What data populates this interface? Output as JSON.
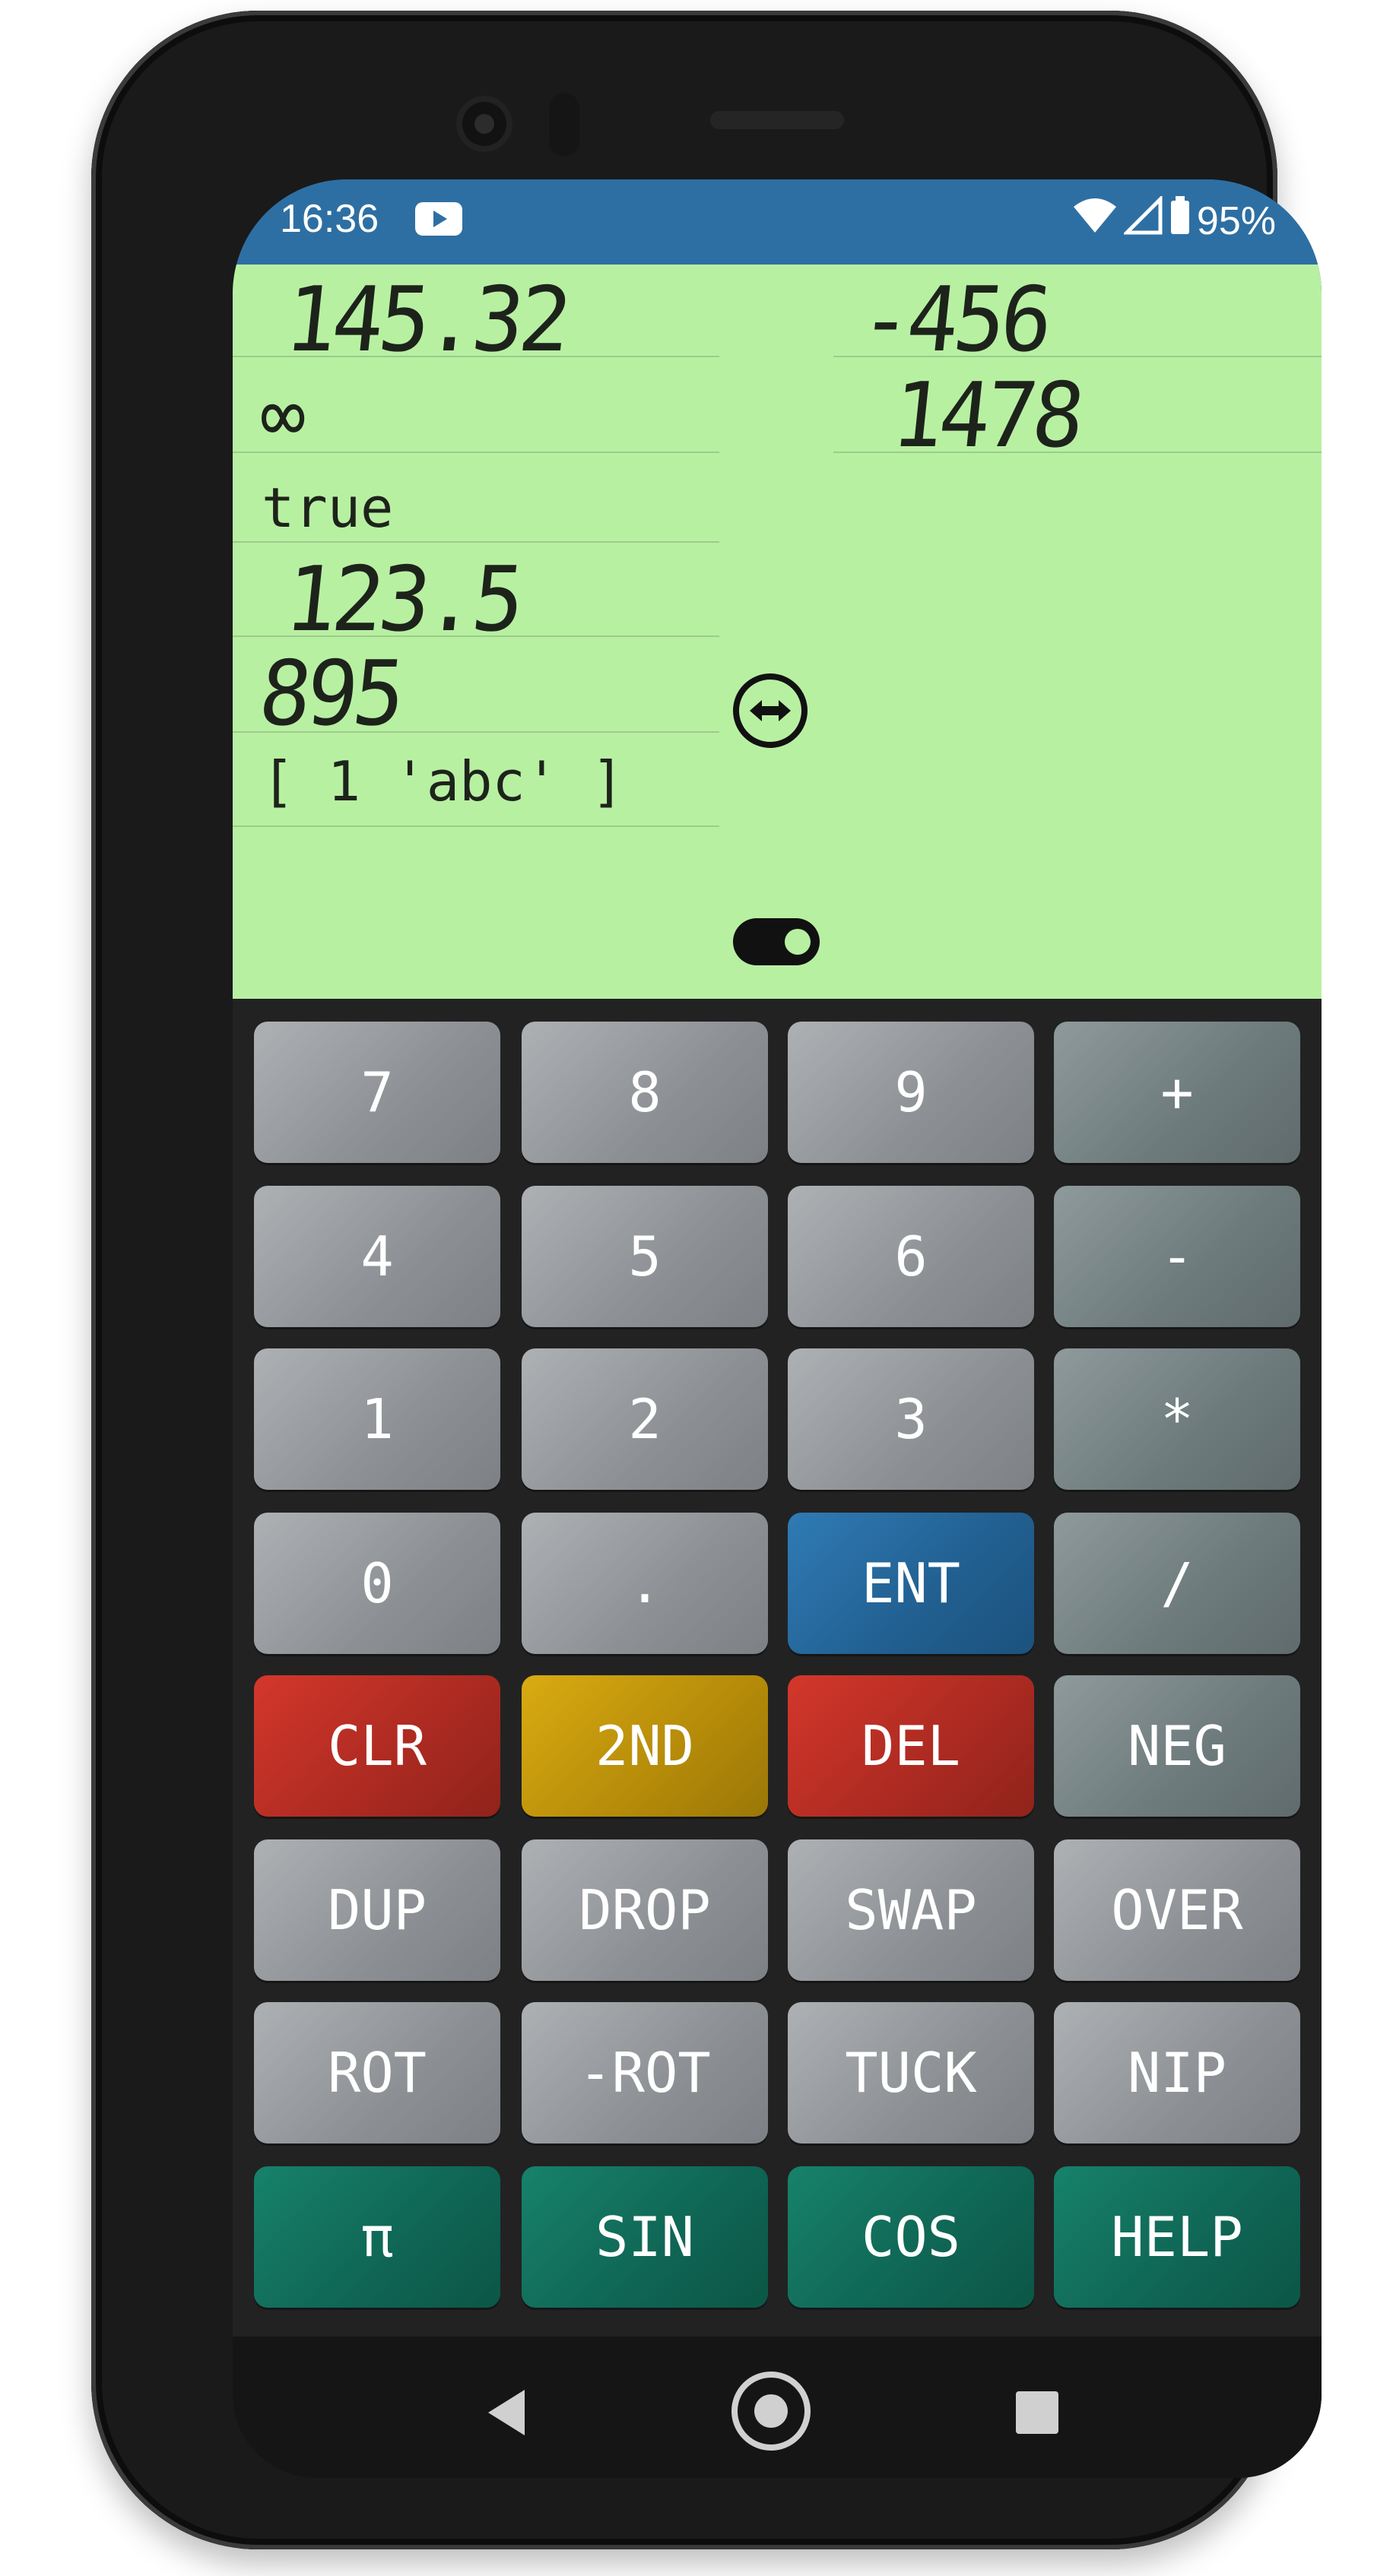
{
  "status_bar": {
    "time": "16:36",
    "battery": "95%"
  },
  "display": {
    "left_stack": [
      "145.32",
      "∞",
      "true",
      "123.5",
      "895",
      "[ 1 'abc' ]"
    ],
    "right_stack": [
      "-456",
      "1478"
    ]
  },
  "keys": [
    [
      "7",
      "8",
      "9",
      "+"
    ],
    [
      "4",
      "5",
      "6",
      "-"
    ],
    [
      "1",
      "2",
      "3",
      "*"
    ],
    [
      "0",
      ".",
      "ENT",
      "/"
    ],
    [
      "CLR",
      "2ND",
      "DEL",
      "NEG"
    ],
    [
      "DUP",
      "DROP",
      "SWAP",
      "OVER"
    ],
    [
      "ROT",
      "-ROT",
      "TUCK",
      "NIP"
    ],
    [
      "π",
      "SIN",
      "COS",
      "HELP"
    ]
  ],
  "colors": {
    "status_bar": "#2e6fa3",
    "display_bg": "#b8f0a2",
    "enter_key": "#215f90",
    "clear_delete_keys": "#ab2a21",
    "second_key": "#b58b09",
    "function_keys": "#0f6554"
  }
}
